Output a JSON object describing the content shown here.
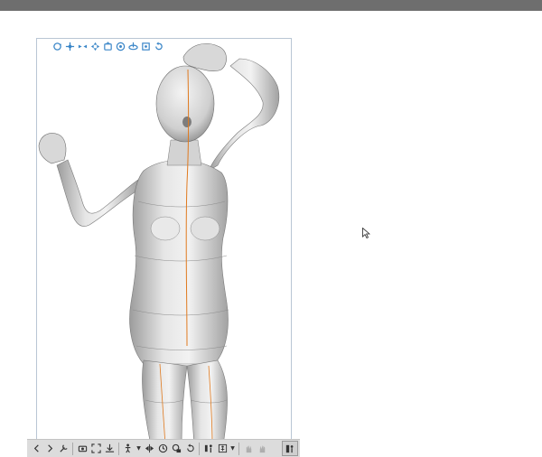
{
  "window": {
    "topbar_color": "#6e6e6e",
    "background": "#ffffff"
  },
  "panel": {
    "border_color": "#b9c6d4"
  },
  "gizmo": {
    "accent": "#3a86c8",
    "items": [
      {
        "name": "rotate-view-icon"
      },
      {
        "name": "pan-view-icon"
      },
      {
        "name": "zoom-view-icon"
      },
      {
        "name": "move-object-icon"
      },
      {
        "name": "rotate-object-icon"
      },
      {
        "name": "camera-icon"
      },
      {
        "name": "plane-rotate-icon"
      },
      {
        "name": "snap-icon"
      },
      {
        "name": "reset-icon"
      }
    ]
  },
  "toolbar": {
    "items": [
      {
        "name": "prev-icon",
        "glyph": "<"
      },
      {
        "name": "next-icon",
        "glyph": ">"
      },
      {
        "name": "wrench-icon"
      },
      {
        "name": "camera-settings-icon"
      },
      {
        "name": "fit-view-icon"
      },
      {
        "name": "ground-icon"
      },
      {
        "name": "pose-icon"
      },
      {
        "name": "flip-icon"
      },
      {
        "name": "clock-icon"
      },
      {
        "name": "joint-lock-icon"
      },
      {
        "name": "reset-pose-icon"
      },
      {
        "name": "body-shape-icon"
      },
      {
        "name": "figure-icon"
      },
      {
        "name": "left-hand-icon"
      },
      {
        "name": "right-hand-icon"
      }
    ],
    "end_icon": "mannequin-icon"
  }
}
